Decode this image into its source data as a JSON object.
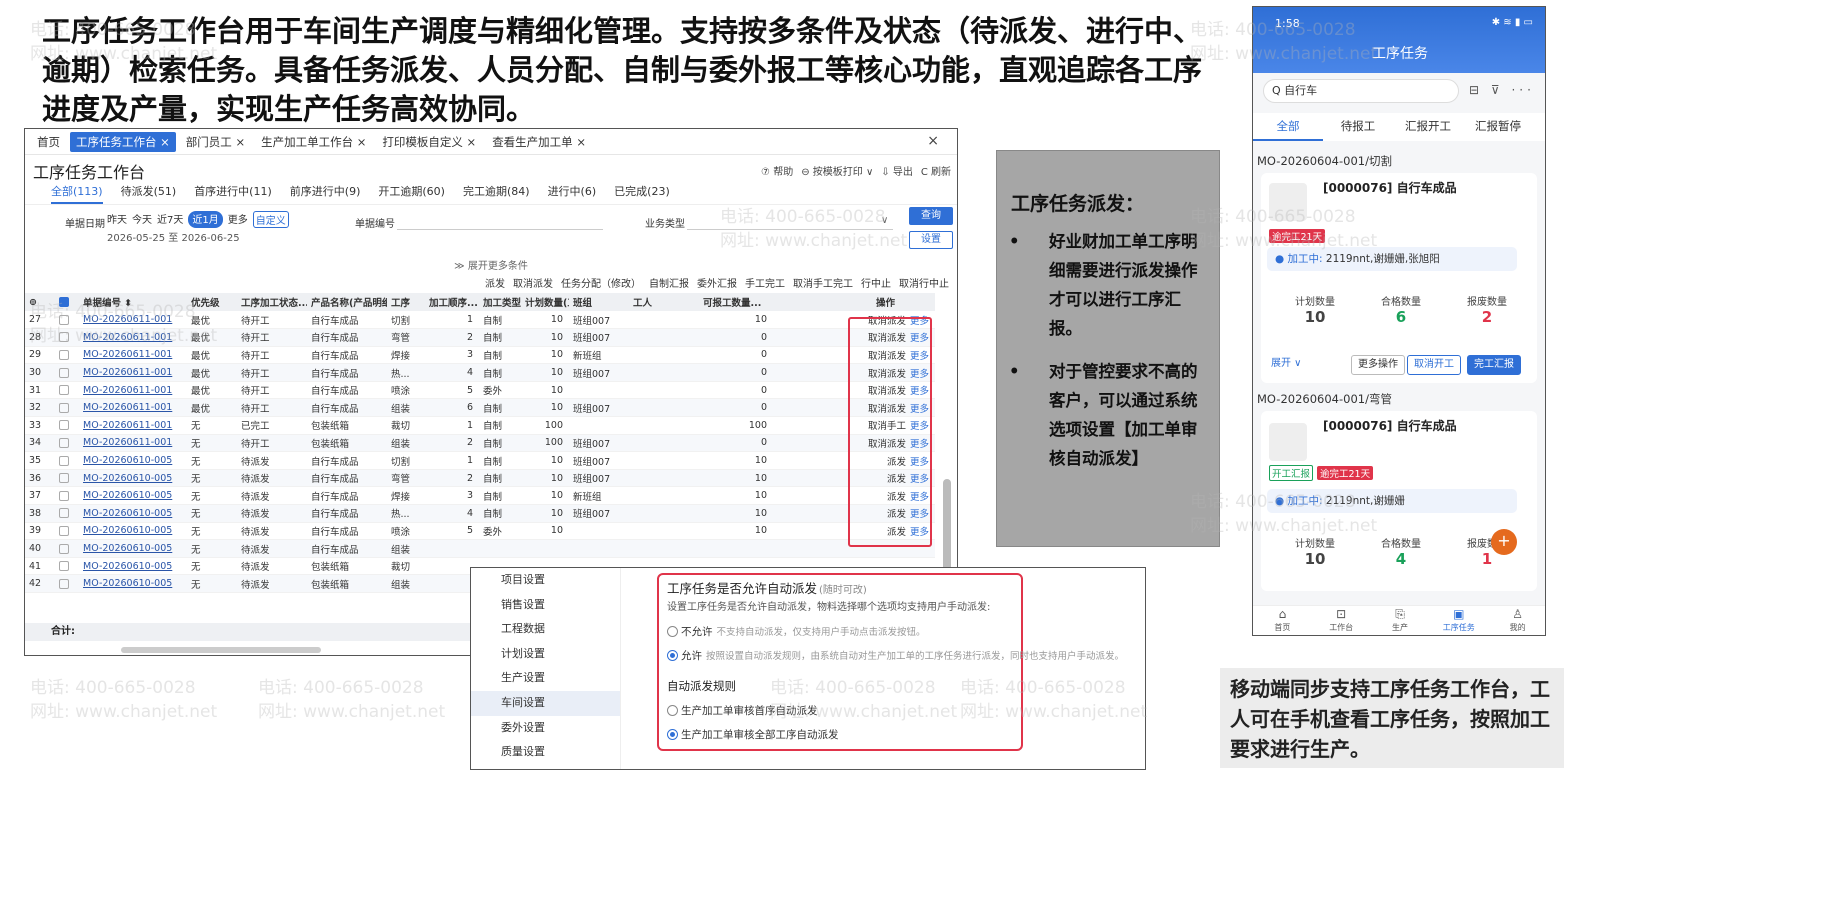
{
  "heading": "工序任务工作台用于车间生产调度与精细化管理。支持按多条件及状态（待派发、进行中、逾期）检索任务。具备任务派发、人员分配、自制与委外报工等核心功能，直观追踪各工序进度及产量，实现生产任务高效协同。",
  "watermark": {
    "phone": "电话: 400-665-0028",
    "site": "网址: www.chanjet.net"
  },
  "desktop": {
    "tabs": [
      "首页",
      "工序任务工作台 ×",
      "部门员工 ×",
      "生产加工单工作台 ×",
      "打印模板自定义 ×",
      "查看生产加工单 ×"
    ],
    "tab_close": "×",
    "title": "工序任务工作台",
    "tools": [
      "⑦ 帮助",
      "⊖ 按模板打印 ∨",
      "⇩ 导出",
      "C 刷新"
    ],
    "status_tabs": [
      "全部(113)",
      "待派发(51)",
      "首序进行中(11)",
      "前序进行中(9)",
      "开工逾期(60)",
      "完工逾期(84)",
      "进行中(6)",
      "已完成(23)"
    ],
    "filters": {
      "date_label": "单据日期",
      "date_options": [
        "昨天",
        "今天",
        "近7天",
        "近1月",
        "更多",
        "自定义"
      ],
      "date_range": "2026-05-25 至 2026-06-25",
      "number_label": "单据编号",
      "type_label": "业务类型",
      "query": "查询",
      "settings": "设置",
      "expand": "≫ 展开更多条件"
    },
    "actions": [
      "派发",
      "取消派发",
      "任务分配（修改）",
      "自制汇报",
      "委外汇报",
      "手工完工",
      "取消手工完工",
      "行中止",
      "取消行中止"
    ],
    "columns": [
      "⊚",
      "",
      "单据编号 ⬍",
      "优先级",
      "工序加工状态...",
      "产品名称(产品明细)",
      "工序",
      "加工顺序...",
      "加工类型",
      "计划数量(工",
      "班组",
      "工人",
      "可报工数量...",
      "操作"
    ],
    "rows": [
      {
        "i": "27",
        "no": "MO-20260611-001",
        "pri": "最优",
        "status": "待开工",
        "prod": "自行车成品",
        "proc": "切割",
        "seq": "1",
        "type": "自制",
        "qty": "10",
        "team": "班组007",
        "worker": "",
        "rep": "10",
        "op": "取消派发",
        "more": "更多"
      },
      {
        "i": "28",
        "no": "MO-20260611-001",
        "pri": "最优",
        "status": "待开工",
        "prod": "自行车成品",
        "proc": "弯管",
        "seq": "2",
        "type": "自制",
        "qty": "10",
        "team": "班组007",
        "worker": "",
        "rep": "0",
        "op": "取消派发",
        "more": "更多"
      },
      {
        "i": "29",
        "no": "MO-20260611-001",
        "pri": "最优",
        "status": "待开工",
        "prod": "自行车成品",
        "proc": "焊接",
        "seq": "3",
        "type": "自制",
        "qty": "10",
        "team": "新班组",
        "worker": "",
        "rep": "0",
        "op": "取消派发",
        "more": "更多"
      },
      {
        "i": "30",
        "no": "MO-20260611-001",
        "pri": "最优",
        "status": "待开工",
        "prod": "自行车成品",
        "proc": "热...",
        "seq": "4",
        "type": "自制",
        "qty": "10",
        "team": "班组007",
        "worker": "",
        "rep": "0",
        "op": "取消派发",
        "more": "更多"
      },
      {
        "i": "31",
        "no": "MO-20260611-001",
        "pri": "最优",
        "status": "待开工",
        "prod": "自行车成品",
        "proc": "喷涂",
        "seq": "5",
        "type": "委外",
        "qty": "10",
        "team": "",
        "worker": "",
        "rep": "0",
        "op": "取消派发",
        "more": "更多"
      },
      {
        "i": "32",
        "no": "MO-20260611-001",
        "pri": "最优",
        "status": "待开工",
        "prod": "自行车成品",
        "proc": "组装",
        "seq": "6",
        "type": "自制",
        "qty": "10",
        "team": "班组007",
        "worker": "",
        "rep": "0",
        "op": "取消派发",
        "more": "更多"
      },
      {
        "i": "33",
        "no": "MO-20260611-001",
        "pri": "无",
        "status": "已完工",
        "prod": "包装纸箱",
        "proc": "裁切",
        "seq": "1",
        "type": "自制",
        "qty": "100",
        "team": "",
        "worker": "",
        "rep": "100",
        "op": "取消手工",
        "more": "更多"
      },
      {
        "i": "34",
        "no": "MO-20260611-001",
        "pri": "无",
        "status": "待开工",
        "prod": "包装纸箱",
        "proc": "组装",
        "seq": "2",
        "type": "自制",
        "qty": "100",
        "team": "班组007",
        "worker": "",
        "rep": "0",
        "op": "取消派发",
        "more": "更多"
      },
      {
        "i": "35",
        "no": "MO-20260610-005",
        "pri": "无",
        "status": "待派发",
        "prod": "自行车成品",
        "proc": "切割",
        "seq": "1",
        "type": "自制",
        "qty": "10",
        "team": "班组007",
        "worker": "",
        "rep": "10",
        "op": "派发",
        "more": "更多"
      },
      {
        "i": "36",
        "no": "MO-20260610-005",
        "pri": "无",
        "status": "待派发",
        "prod": "自行车成品",
        "proc": "弯管",
        "seq": "2",
        "type": "自制",
        "qty": "10",
        "team": "班组007",
        "worker": "",
        "rep": "10",
        "op": "派发",
        "more": "更多"
      },
      {
        "i": "37",
        "no": "MO-20260610-005",
        "pri": "无",
        "status": "待派发",
        "prod": "自行车成品",
        "proc": "焊接",
        "seq": "3",
        "type": "自制",
        "qty": "10",
        "team": "新班组",
        "worker": "",
        "rep": "10",
        "op": "派发",
        "more": "更多"
      },
      {
        "i": "38",
        "no": "MO-20260610-005",
        "pri": "无",
        "status": "待派发",
        "prod": "自行车成品",
        "proc": "热...",
        "seq": "4",
        "type": "自制",
        "qty": "10",
        "team": "班组007",
        "worker": "",
        "rep": "10",
        "op": "派发",
        "more": "更多"
      },
      {
        "i": "39",
        "no": "MO-20260610-005",
        "pri": "无",
        "status": "待派发",
        "prod": "自行车成品",
        "proc": "喷涂",
        "seq": "5",
        "type": "委外",
        "qty": "10",
        "team": "",
        "worker": "",
        "rep": "10",
        "op": "派发",
        "more": "更多"
      },
      {
        "i": "40",
        "no": "MO-20260610-005",
        "pri": "无",
        "status": "待派发",
        "prod": "自行车成品",
        "proc": "组装",
        "seq": "",
        "type": "",
        "qty": "",
        "team": "",
        "worker": "",
        "rep": "",
        "op": "",
        "more": ""
      },
      {
        "i": "41",
        "no": "MO-20260610-005",
        "pri": "无",
        "status": "待派发",
        "prod": "包装纸箱",
        "proc": "裁切",
        "seq": "",
        "type": "",
        "qty": "",
        "team": "",
        "worker": "",
        "rep": "",
        "op": "",
        "more": ""
      },
      {
        "i": "42",
        "no": "MO-20260610-005",
        "pri": "无",
        "status": "待派发",
        "prod": "包装纸箱",
        "proc": "组装",
        "seq": "",
        "type": "",
        "qty": "",
        "team": "",
        "worker": "",
        "rep": "",
        "op": "",
        "more": ""
      }
    ],
    "total_label": "合计:"
  },
  "settings_panel": {
    "nav": [
      "项目设置",
      "销售设置",
      "工程数据",
      "计划设置",
      "生产设置",
      "车间设置",
      "委外设置",
      "质量设置"
    ],
    "active_nav": "车间设置",
    "title": "工序任务是否允许自动派发",
    "title_sub": "(随时可改)",
    "desc": "设置工序任务是否允许自动派发，物料选择哪个选项均支持用户手动派发:",
    "opt_no": "不允许",
    "opt_no_hint": "不支持自动派发，仅支持用户手动点击派发按钮。",
    "opt_yes": "允许",
    "opt_yes_hint": "按照设置自动派发规则，由系统自动对生产加工单的工序任务进行派发，同时也支持用户手动派发。",
    "rule_title": "自动派发规则",
    "rule_first": "生产加工单审核首序自动派发",
    "rule_all": "生产加工单审核全部工序自动派发"
  },
  "grey_box": {
    "title": "工序任务派发：",
    "bullet_mark": "•",
    "bullets": [
      "好业财加工单工序明细需要进行派发操作才可以进行工序汇报。",
      "对于管控要求不高的客户，可以通过系统选项设置【加工单审核自动派发】"
    ]
  },
  "phone": {
    "time": "1:58",
    "status_icons": "✱ ≋ ▮ ▭",
    "title": "工序任务",
    "search_icon": "Q",
    "search": "自行车",
    "header_icons": "⊟ ⊽ ···",
    "tabs": [
      "全部",
      "待报工",
      "汇报开工",
      "汇报暂停"
    ],
    "card1": {
      "order": "MO-20260604-001/切割",
      "product": "[0000076] 自行车成品",
      "badge": "逾完工21天",
      "status": "● 加工中:",
      "workers": "2119nnt,谢姗姗,张旭阳",
      "plan_label": "计划数量",
      "plan": "10",
      "ok_label": "合格数量",
      "ok": "6",
      "scrap_label": "报废数量",
      "scrap": "2",
      "expand": "展开 ∨",
      "btn_more": "更多操作",
      "btn_cancel": "取消开工",
      "btn_report": "完工汇报"
    },
    "card2": {
      "order": "MO-20260604-001/弯管",
      "product": "[0000076] 自行车成品",
      "badge_green": "开工汇报",
      "badge": "逾完工21天",
      "status": "● 加工中:",
      "workers": "2119nnt,谢姗姗",
      "plan_label": "计划数量",
      "plan": "10",
      "ok_label": "合格数量",
      "ok": "4",
      "scrap_label": "报废数量",
      "scrap": "1"
    },
    "fab": "+",
    "nav": [
      {
        "icon": "⌂",
        "label": "首页"
      },
      {
        "icon": "⊡",
        "label": "工作台"
      },
      {
        "icon": "⎘",
        "label": "生产"
      },
      {
        "icon": "▣",
        "label": "工序任务"
      },
      {
        "icon": "♙",
        "label": "我的"
      }
    ]
  },
  "caption": "移动端同步支持工序任务工作台，工人可在手机查看工序任务，按照加工要求进行生产。",
  "colors": {
    "accent": "#2f6fd6",
    "highlight": "#e0344a",
    "ok_green": "#1aa15a"
  }
}
